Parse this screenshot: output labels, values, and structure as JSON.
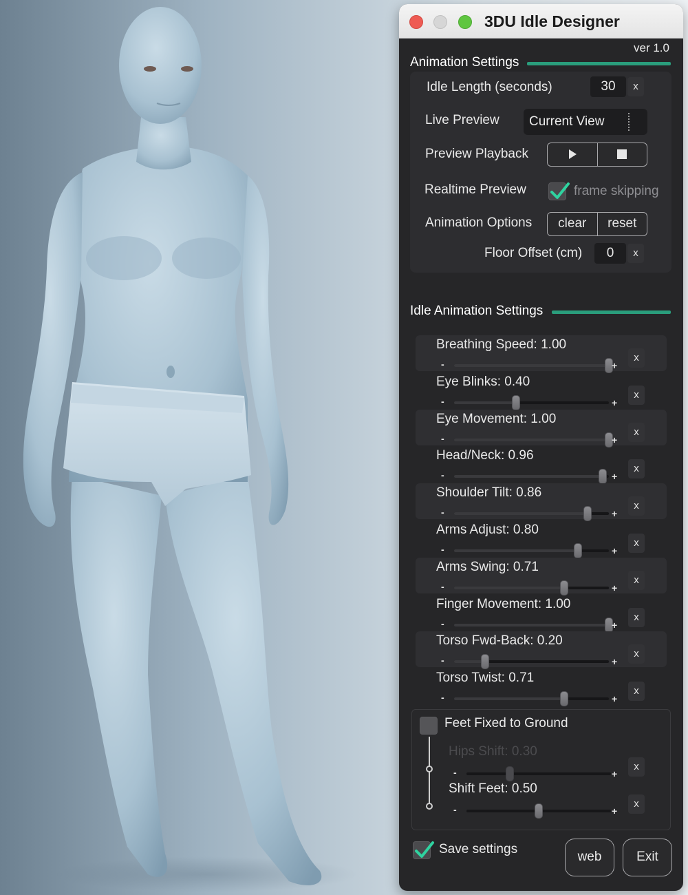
{
  "window": {
    "title": "3DU Idle Designer",
    "version": "ver 1.0"
  },
  "animation_settings": {
    "heading": "Animation Settings",
    "idle_length": {
      "label": "Idle Length (seconds)",
      "value": "30"
    },
    "live_preview": {
      "label": "Live Preview",
      "value": "Current View"
    },
    "preview_playback": {
      "label": "Preview Playback",
      "play_icon": "play-icon",
      "stop_icon": "stop-icon"
    },
    "realtime_preview": {
      "label": "Realtime Preview",
      "checked": true,
      "option_label": "frame skipping"
    },
    "animation_options": {
      "label": "Animation Options",
      "clear": "clear",
      "reset": "reset"
    },
    "floor_offset": {
      "label": "Floor Offset (cm)",
      "value": "0"
    }
  },
  "idle_settings": {
    "heading": "Idle Animation Settings",
    "sliders": [
      {
        "label": "Breathing Speed: 1.00",
        "value": 1.0
      },
      {
        "label": "Eye Blinks: 0.40",
        "value": 0.4
      },
      {
        "label": "Eye Movement: 1.00",
        "value": 1.0
      },
      {
        "label": "Head/Neck: 0.96",
        "value": 0.96
      },
      {
        "label": "Shoulder Tilt: 0.86",
        "value": 0.86
      },
      {
        "label": "Arms Adjust: 0.80",
        "value": 0.8
      },
      {
        "label": "Arms Swing: 0.71",
        "value": 0.71
      },
      {
        "label": "Finger Movement: 1.00",
        "value": 1.0
      },
      {
        "label": "Torso Fwd-Back: 0.20",
        "value": 0.2
      },
      {
        "label": "Torso Twist: 0.71",
        "value": 0.71
      }
    ],
    "feet_fixed": {
      "label": "Feet Fixed to Ground",
      "checked": false,
      "hips_shift": {
        "label": "Hips Shift: 0.30",
        "value": 0.3,
        "disabled": true
      },
      "shift_feet": {
        "label": "Shift Feet: 0.50",
        "value": 0.5
      }
    }
  },
  "footer": {
    "save_settings": {
      "label": "Save settings",
      "checked": true
    },
    "web": "web",
    "exit": "Exit"
  },
  "symbols": {
    "clear_x": "x",
    "minus": "-",
    "plus": "+"
  },
  "colors": {
    "accent_green": "#2a9d7c",
    "check_green": "#2fd3a0",
    "panel_bg": "#262628"
  }
}
